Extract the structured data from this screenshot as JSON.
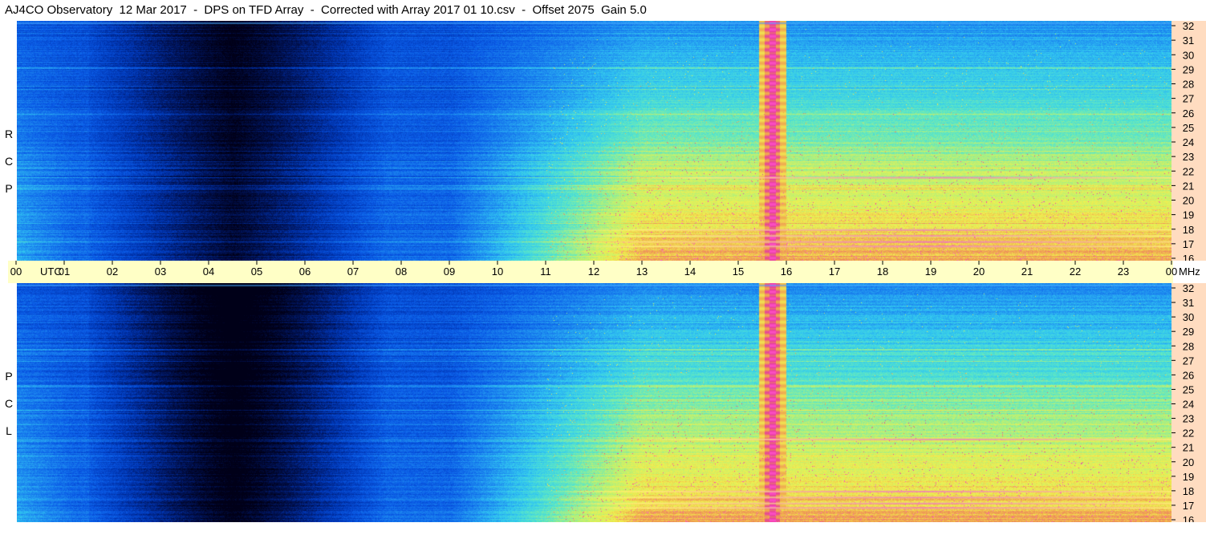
{
  "title": "AJ4CO Observatory  12 Mar 2017  -  DPS on TFD Array  -  Corrected with Array 2017 01 10.csv  -  Offset 2075  Gain 5.0",
  "chart_data": [
    {
      "type": "heatmap",
      "panel": "top",
      "side_label": [
        "R",
        "C",
        "P"
      ],
      "xlabel": "UTC",
      "ylabel": "MHz",
      "xlim": [
        0,
        24
      ],
      "ylim": [
        16,
        32
      ],
      "x_ticks": [
        "00",
        "01",
        "02",
        "03",
        "04",
        "05",
        "06",
        "07",
        "08",
        "09",
        "10",
        "11",
        "12",
        "13",
        "14",
        "15",
        "16",
        "17",
        "18",
        "19",
        "20",
        "21",
        "22",
        "23",
        "00"
      ],
      "y_ticks": [
        32,
        31,
        30,
        29,
        28,
        27,
        26,
        25,
        24,
        23,
        22,
        21,
        20,
        19,
        18,
        17,
        16
      ],
      "colormap": [
        "#000018",
        "#00145a",
        "#0036b4",
        "#0a5ae6",
        "#1e8cf0",
        "#32c8f0",
        "#5ae6c8",
        "#b4f078",
        "#f0f050",
        "#f0a050",
        "#e63ca0",
        "#ff50c8"
      ],
      "features": {
        "solar_burst_center_utc": 15.7,
        "rfi_lines_mhz": [
          16.9,
          17.2,
          17.6,
          18.0,
          21.5
        ],
        "dark_region_utc": [
          2.5,
          6.5
        ],
        "bright_region_utc": [
          9.5,
          24
        ]
      }
    },
    {
      "type": "heatmap",
      "panel": "bottom",
      "side_label": [
        "L",
        "C",
        "P"
      ],
      "xlabel": "UTC",
      "ylabel": "MHz",
      "xlim": [
        0,
        24
      ],
      "ylim": [
        16,
        32
      ],
      "x_ticks": [
        "00",
        "01",
        "02",
        "03",
        "04",
        "05",
        "06",
        "07",
        "08",
        "09",
        "10",
        "11",
        "12",
        "13",
        "14",
        "15",
        "16",
        "17",
        "18",
        "19",
        "20",
        "21",
        "22",
        "23",
        "00"
      ],
      "y_ticks": [
        32,
        31,
        30,
        29,
        28,
        27,
        26,
        25,
        24,
        23,
        22,
        21,
        20,
        19,
        18,
        17,
        16
      ],
      "colormap": [
        "#000018",
        "#00145a",
        "#0036b4",
        "#0a5ae6",
        "#1e8cf0",
        "#32c8f0",
        "#5ae6c8",
        "#b4f078",
        "#f0f050",
        "#f0a050",
        "#e63ca0",
        "#ff50c8"
      ],
      "features": {
        "solar_burst_center_utc": 15.7,
        "rfi_lines_mhz": [
          16.9,
          17.2,
          17.6,
          18.0,
          21.5
        ],
        "dark_region_utc": [
          2.5,
          6.5
        ],
        "bright_region_utc": [
          9.5,
          24
        ]
      }
    }
  ]
}
